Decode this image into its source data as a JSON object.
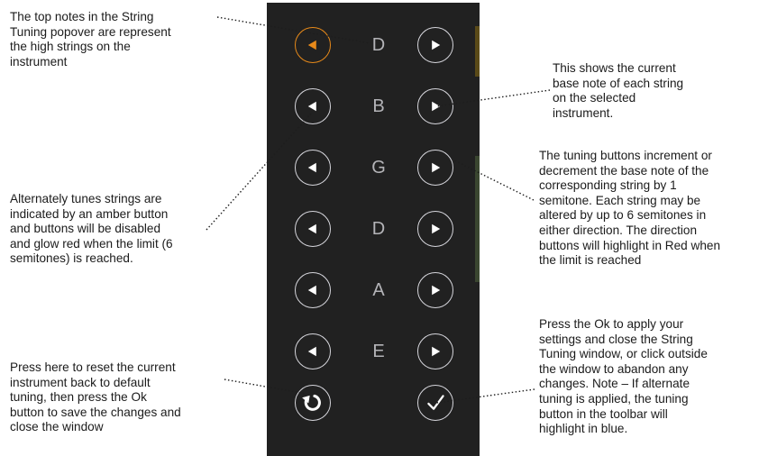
{
  "annotations": {
    "top_notes": "The top notes in the String\nTuning popover are represent\nthe high strings on the\ninstrument",
    "alternate_tunes": "Alternately tunes strings are\nindicated by an amber button\nand buttons will be disabled\nand glow red when the limit (6\nsemitones) is reached.",
    "reset": "Press here to reset the current\ninstrument back to default\ntuning, then press the Ok\nbutton to save the changes and\nclose the window",
    "base_note": "This shows the current\nbase note of each string\non the selected\ninstrument.",
    "tuning_buttons": "The tuning buttons increment or\ndecrement the base note of the\ncorresponding string by 1\nsemitone. Each string may be\naltered by up to 6 semitones in\neither direction. The direction\nbuttons will highlight in Red when\nthe limit is reached",
    "ok": "Press the Ok to apply your\nsettings and close the String\nTuning window, or click outside\nthe window to abandon any\nchanges. Note – If alternate\ntuning is applied, the tuning\nbutton in the toolbar will\nhighlight in blue."
  },
  "popover": {
    "strings": [
      {
        "note": "D",
        "decrement_highlight": "amber"
      },
      {
        "note": "B",
        "decrement_highlight": "none"
      },
      {
        "note": "G",
        "decrement_highlight": "none"
      },
      {
        "note": "D",
        "decrement_highlight": "none"
      },
      {
        "note": "A",
        "decrement_highlight": "none"
      },
      {
        "note": "E",
        "decrement_highlight": "none"
      }
    ],
    "icons": {
      "decrement": "left-arrow-icon",
      "increment": "right-arrow-icon",
      "reset": "reset-icon",
      "ok": "checkmark-icon"
    }
  },
  "colors": {
    "popover_background": "#212121",
    "button_outline": "#d6d6dc",
    "amber_highlight": "#e88a1a",
    "note_text": "#b4b4b8"
  }
}
